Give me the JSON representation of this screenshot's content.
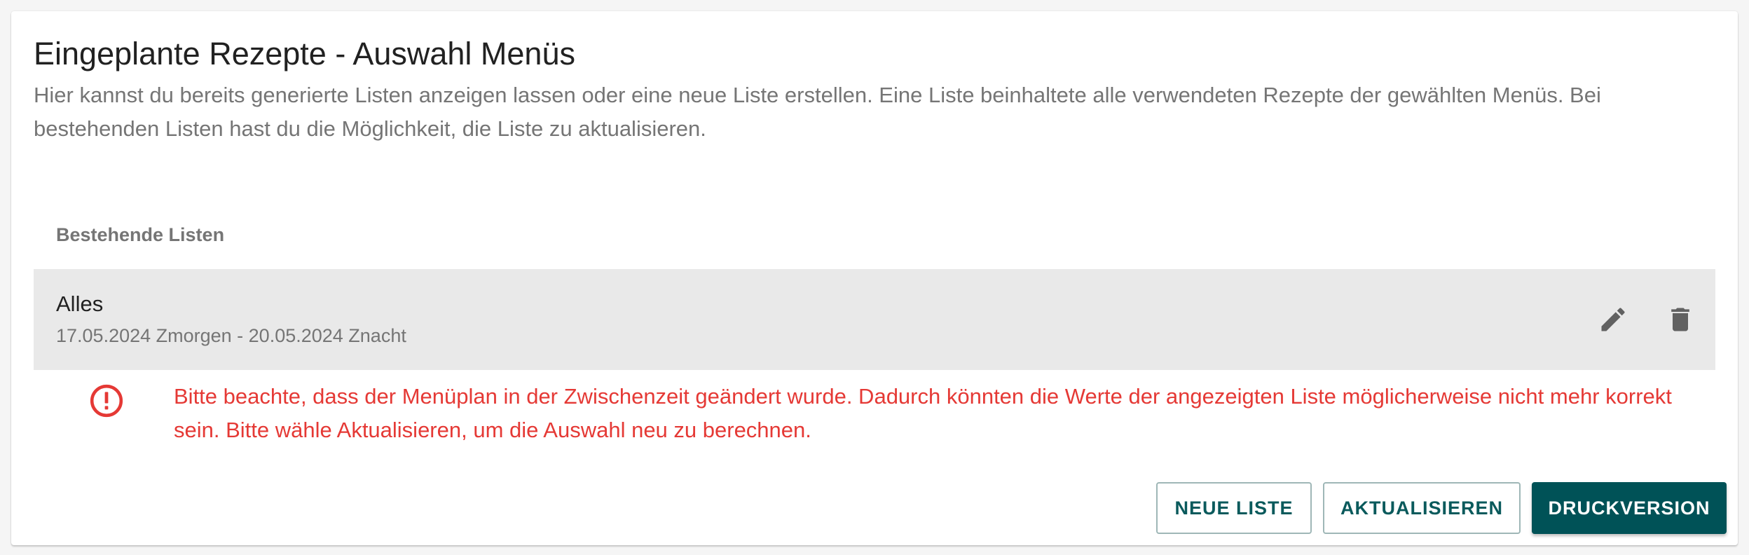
{
  "card": {
    "title": "Eingeplante Rezepte - Auswahl Menüs",
    "subtitle": "Hier kannst du bereits generierte Listen anzeigen lassen oder eine neue Liste erstellen. Eine Liste beinhaltete alle verwendeten Rezepte der gewählten Menüs. Bei bestehenden Listen hast du die Möglichkeit, die Liste zu aktualisieren."
  },
  "list": {
    "header": "Bestehende Listen",
    "items": [
      {
        "title": "Alles",
        "subtitle": "17.05.2024 Zmorgen - 20.05.2024 Znacht",
        "actions": [
          "pencil-icon",
          "trash-icon"
        ]
      }
    ]
  },
  "warning": {
    "icon": "error-circle-icon",
    "text": "Bitte beachte, dass der Menüplan in der Zwischenzeit geändert wurde. Dadurch könnten die Werte der angezeigten Liste möglicherweise nicht mehr korrekt sein. Bitte wähle Aktualisieren, um die Auswahl neu zu berechnen."
  },
  "actions": {
    "new_list": "NEUE LISTE",
    "refresh": "AKTUALISIEREN",
    "print": "DRUCKVERSION"
  },
  "colors": {
    "primary": "#005257",
    "error": "#e53935",
    "list_item_bg": "#e9e9e9"
  }
}
